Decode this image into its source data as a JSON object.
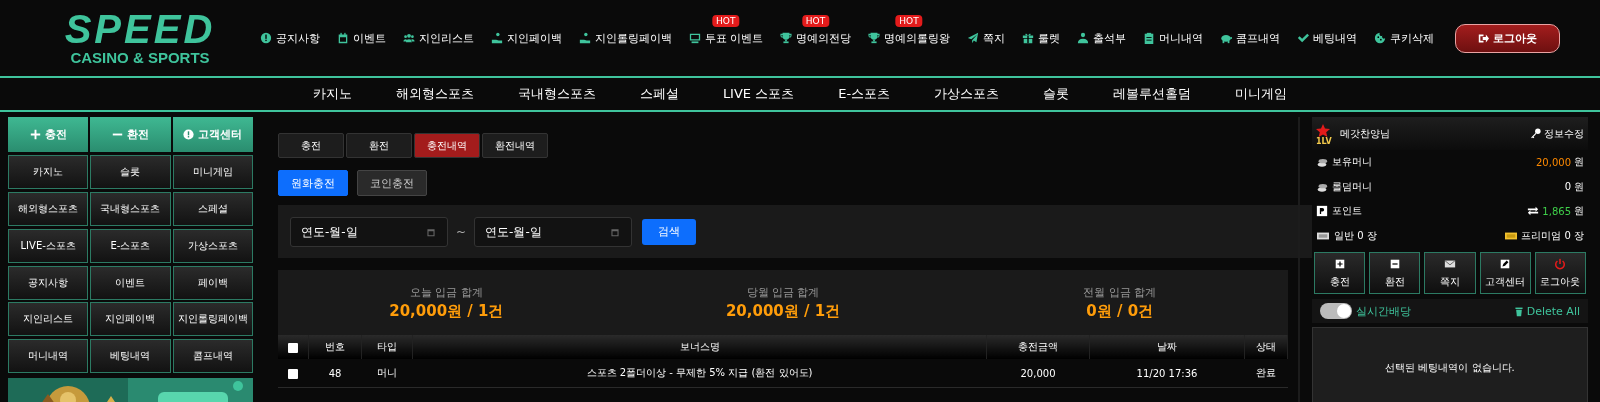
{
  "logo": {
    "title": "SPEED",
    "subtitle": "CASINO & SPORTS"
  },
  "top_links": [
    {
      "label": "공지사항"
    },
    {
      "label": "이벤트"
    },
    {
      "label": "지인리스트"
    },
    {
      "label": "지인페이백"
    },
    {
      "label": "지인롤링페이백"
    },
    {
      "label": "투표 이벤트",
      "badge": "HOT"
    },
    {
      "label": "명예의전당",
      "badge": "HOT"
    },
    {
      "label": "명예의롤링왕",
      "badge": "HOT"
    },
    {
      "label": "쪽지"
    },
    {
      "label": "룰렛"
    },
    {
      "label": "출석부"
    },
    {
      "label": "머니내역"
    },
    {
      "label": "콤프내역"
    },
    {
      "label": "베팅내역"
    },
    {
      "label": "쿠키삭제"
    }
  ],
  "logout_button": "로그아웃",
  "main_nav": [
    "카지노",
    "해외형스포츠",
    "국내형스포츠",
    "스페셜",
    "LIVE 스포츠",
    "E-스포츠",
    "가상스포츠",
    "슬롯",
    "레볼루션홀덤",
    "미니게임"
  ],
  "sidebar": {
    "actions": [
      "충전",
      "환전",
      "고객센터"
    ],
    "menu": [
      "카지노",
      "슬롯",
      "미니게임",
      "해외형스포츠",
      "국내형스포츠",
      "스페셜",
      "LIVE-스포츠",
      "E-스포츠",
      "가상스포츠",
      "공지사항",
      "이벤트",
      "페이백",
      "지인리스트",
      "지인페이백",
      "지인롤링페이백",
      "머니내역",
      "베팅내역",
      "콤프내역"
    ],
    "banner": {
      "kind": "picture"
    }
  },
  "tabs": [
    {
      "label": "충전",
      "selected": false
    },
    {
      "label": "환전",
      "selected": false
    },
    {
      "label": "충전내역",
      "selected": true
    },
    {
      "label": "환전내역",
      "selected": false
    }
  ],
  "sub_tabs": [
    {
      "label": "원화충전",
      "selected": true
    },
    {
      "label": "코인충전",
      "selected": false
    }
  ],
  "filter": {
    "from": {
      "placeholder": "연도-월-일"
    },
    "separator": "~",
    "to": {
      "placeholder": "연도-월-일"
    },
    "search_button": "검색"
  },
  "summary": [
    {
      "label": "오늘 입금 합계",
      "value": "20,000원 / 1건"
    },
    {
      "label": "당월 입금 합계",
      "value": "20,000원 / 1건"
    },
    {
      "label": "전월 입금 합계",
      "value": "0원 / 0건"
    }
  ],
  "table": {
    "header_checked": false,
    "columns": [
      "번호",
      "타입",
      "보너스명",
      "충전금액",
      "날짜",
      "상태"
    ],
    "rows": [
      {
        "checked": false,
        "cells": [
          "48",
          "머니",
          "스포츠 2폴더이상 - 무제한 5% 지급 (환전 있어도)",
          "20,000",
          "11/20 17:36",
          "완료"
        ]
      }
    ]
  },
  "profile": {
    "level_badge": "1LV",
    "name": "메갓찬양님",
    "edit_link": "정보수정",
    "balances": [
      {
        "kind": "money",
        "label": "보유머니",
        "value": "20,000",
        "unit": "원"
      },
      {
        "kind": "rolling",
        "label": "롤덤머니",
        "value": "0",
        "unit": "원"
      },
      {
        "kind": "point",
        "label": "포인트",
        "value": "1,865",
        "unit": "원"
      }
    ],
    "tickets": {
      "general": "일반 0 장",
      "premium": "프리미엄 0 장"
    },
    "quick_buttons": [
      "충전",
      "환전",
      "쪽지",
      "고객센터",
      "로그아웃"
    ],
    "live_odds": {
      "label": "실시간배당",
      "on": true,
      "delete_all": "Delete All"
    },
    "empty_message": "선택된 베팅내역이 없습니다."
  }
}
